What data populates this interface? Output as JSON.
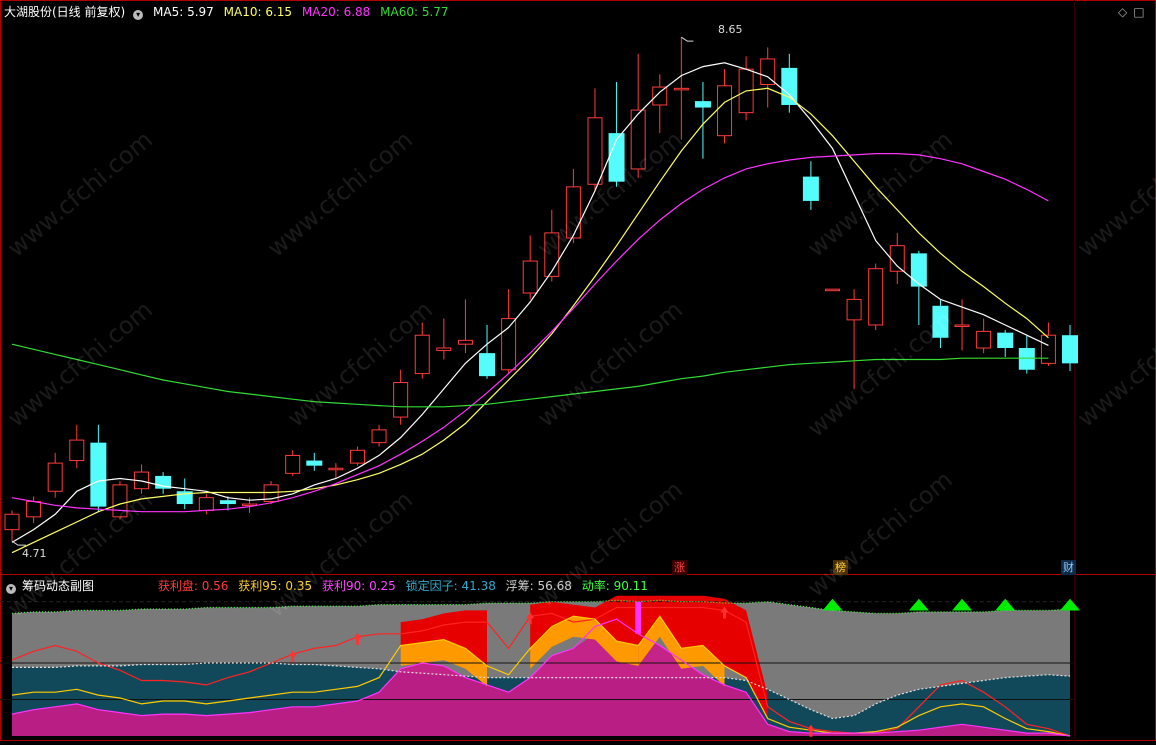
{
  "top_header": {
    "title": "大湖股份(日线 前复权)",
    "ma5_label": "MA5: 5.97",
    "ma10_label": "MA10: 6.15",
    "ma20_label": "MA20: 6.88",
    "ma60_label": "MA60: 5.77"
  },
  "top_icons": {
    "right_a": "◇",
    "right_b": "□"
  },
  "price_annotations": {
    "high": "8.65",
    "low": "4.71"
  },
  "event_tags": {
    "zhang": "涨",
    "bang": "榜",
    "cai": "财"
  },
  "bottom_header": {
    "title": "筹码动态副图",
    "huolipan": "获利盘: 0.56",
    "huoli95": "获利95: 0.35",
    "huoli90": "获利90: 0.25",
    "suoding": "锁定因子: 41.38",
    "fuchou": "浮筹: 56.68",
    "donglv": "动率: 90.11"
  },
  "watermark": "www.cfchi.com",
  "colors": {
    "up": "#ff3b3b",
    "down": "#54fcfc",
    "ma5": "#ffffff",
    "ma10": "#ffff66",
    "ma20": "#ff33ff",
    "ma60": "#33dd33",
    "grid": "#b00000",
    "gray_area": "#7a7a7a",
    "teal_area": "#12495a",
    "pink_area": "#cc1a88",
    "red_area": "#e60000",
    "orange_area": "#ff9900",
    "green_area": "#00ee00"
  },
  "chart_data": [
    {
      "type": "candlestick",
      "title": "大湖股份(日线 前复权)",
      "ylim": [
        4.5,
        8.8
      ],
      "candles": [
        [
          4.8,
          4.92,
          4.71,
          4.95
        ],
        [
          4.9,
          5.02,
          4.85,
          5.06
        ],
        [
          5.1,
          5.32,
          5.05,
          5.4
        ],
        [
          5.34,
          5.5,
          5.28,
          5.62
        ],
        [
          5.48,
          4.98,
          4.94,
          5.62
        ],
        [
          4.9,
          5.15,
          4.88,
          5.18
        ],
        [
          5.12,
          5.25,
          5.08,
          5.31
        ],
        [
          5.22,
          5.12,
          5.08,
          5.25
        ],
        [
          5.1,
          5.0,
          4.96,
          5.2
        ],
        [
          4.95,
          5.05,
          4.92,
          5.08
        ],
        [
          5.03,
          5.0,
          4.95,
          5.06
        ],
        [
          5.0,
          5.0,
          4.93,
          5.05
        ],
        [
          5.02,
          5.15,
          5.0,
          5.18
        ],
        [
          5.24,
          5.38,
          5.22,
          5.42
        ],
        [
          5.34,
          5.3,
          5.26,
          5.4
        ],
        [
          5.28,
          5.28,
          5.2,
          5.32
        ],
        [
          5.32,
          5.42,
          5.3,
          5.45
        ],
        [
          5.48,
          5.58,
          5.45,
          5.62
        ],
        [
          5.68,
          5.95,
          5.62,
          6.05
        ],
        [
          6.02,
          6.32,
          5.98,
          6.42
        ],
        [
          6.2,
          6.22,
          6.13,
          6.45
        ],
        [
          6.25,
          6.28,
          6.18,
          6.6
        ],
        [
          6.18,
          6.0,
          5.98,
          6.4
        ],
        [
          6.05,
          6.45,
          6.02,
          6.68
        ],
        [
          6.65,
          6.9,
          6.6,
          7.1
        ],
        [
          6.78,
          7.12,
          6.74,
          7.3
        ],
        [
          7.08,
          7.48,
          7.04,
          7.62
        ],
        [
          7.5,
          8.02,
          7.45,
          8.25
        ],
        [
          7.9,
          7.52,
          7.48,
          8.3
        ],
        [
          7.62,
          8.08,
          7.55,
          8.52
        ],
        [
          8.12,
          8.26,
          7.9,
          8.36
        ],
        [
          8.25,
          8.25,
          7.85,
          8.65
        ],
        [
          8.15,
          8.1,
          7.7,
          8.3
        ],
        [
          7.88,
          8.27,
          7.82,
          8.4
        ],
        [
          8.06,
          8.4,
          8.0,
          8.5
        ],
        [
          8.28,
          8.48,
          8.1,
          8.57
        ],
        [
          8.41,
          8.12,
          8.06,
          8.52
        ],
        [
          7.56,
          7.37,
          7.3,
          7.68
        ],
        [
          6.68,
          6.68,
          6.68,
          6.68
        ],
        [
          6.44,
          6.6,
          5.9,
          6.68
        ],
        [
          6.4,
          6.84,
          6.36,
          6.88
        ],
        [
          6.82,
          7.02,
          6.72,
          7.12
        ],
        [
          6.96,
          6.7,
          6.4,
          6.98
        ],
        [
          6.55,
          6.3,
          6.22,
          6.6
        ],
        [
          6.4,
          6.4,
          6.2,
          6.6
        ],
        [
          6.22,
          6.35,
          6.18,
          6.45
        ],
        [
          6.34,
          6.22,
          6.15,
          6.36
        ],
        [
          6.22,
          6.05,
          6.02,
          6.32
        ],
        [
          6.1,
          6.32,
          6.08,
          6.42
        ],
        [
          6.32,
          6.1,
          6.04,
          6.4
        ]
      ],
      "series": [
        {
          "name": "MA5",
          "values": [
            4.7,
            4.8,
            4.92,
            5.1,
            5.18,
            5.2,
            5.18,
            5.14,
            5.12,
            5.1,
            5.05,
            5.03,
            5.04,
            5.08,
            5.15,
            5.2,
            5.28,
            5.38,
            5.52,
            5.7,
            5.9,
            6.1,
            6.25,
            6.38,
            6.58,
            6.82,
            7.1,
            7.45,
            7.85,
            8.05,
            8.22,
            8.35,
            8.42,
            8.45,
            8.4,
            8.34,
            8.2,
            8.0,
            7.78,
            7.42,
            7.06,
            6.86,
            6.72,
            6.6,
            6.54,
            6.48,
            6.4,
            6.32,
            6.24,
            5.97
          ]
        },
        {
          "name": "MA10",
          "values": [
            4.62,
            4.7,
            4.78,
            4.86,
            4.94,
            5.0,
            5.04,
            5.06,
            5.08,
            5.09,
            5.09,
            5.09,
            5.09,
            5.1,
            5.12,
            5.15,
            5.19,
            5.24,
            5.31,
            5.39,
            5.5,
            5.63,
            5.8,
            5.97,
            6.14,
            6.33,
            6.55,
            6.78,
            7.02,
            7.27,
            7.52,
            7.76,
            7.97,
            8.14,
            8.23,
            8.25,
            8.18,
            8.05,
            7.88,
            7.68,
            7.48,
            7.3,
            7.12,
            6.96,
            6.82,
            6.7,
            6.57,
            6.45,
            6.3,
            6.15
          ]
        },
        {
          "name": "MA20",
          "values": [
            5.05,
            5.02,
            4.99,
            4.97,
            4.96,
            4.95,
            4.94,
            4.94,
            4.94,
            4.95,
            4.96,
            4.98,
            5.01,
            5.05,
            5.1,
            5.16,
            5.23,
            5.3,
            5.39,
            5.49,
            5.6,
            5.73,
            5.87,
            6.02,
            6.18,
            6.35,
            6.53,
            6.72,
            6.9,
            7.07,
            7.22,
            7.35,
            7.46,
            7.55,
            7.62,
            7.66,
            7.69,
            7.71,
            7.72,
            7.73,
            7.74,
            7.74,
            7.73,
            7.7,
            7.66,
            7.6,
            7.54,
            7.46,
            7.37,
            6.88
          ]
        },
        {
          "name": "MA60",
          "values": [
            6.25,
            6.21,
            6.17,
            6.13,
            6.09,
            6.05,
            6.01,
            5.97,
            5.94,
            5.91,
            5.88,
            5.86,
            5.84,
            5.82,
            5.8,
            5.79,
            5.78,
            5.77,
            5.76,
            5.76,
            5.76,
            5.77,
            5.78,
            5.8,
            5.82,
            5.84,
            5.86,
            5.88,
            5.9,
            5.92,
            5.95,
            5.98,
            6.0,
            6.03,
            6.05,
            6.07,
            6.09,
            6.1,
            6.11,
            6.12,
            6.13,
            6.13,
            6.13,
            6.13,
            6.14,
            6.14,
            6.14,
            6.14,
            6.14,
            5.77
          ]
        }
      ]
    },
    {
      "type": "area",
      "title": "筹码动态副图",
      "ylim": [
        0,
        100
      ],
      "series": [
        {
          "name": "浮筹",
          "values": [
            84,
            85,
            85,
            86,
            86,
            86,
            87,
            87,
            87,
            88,
            88,
            88,
            88,
            89,
            89,
            89,
            89,
            90,
            90,
            90,
            90,
            90,
            91,
            91,
            91,
            92,
            92,
            92,
            93,
            92,
            93,
            92,
            92,
            91,
            91,
            92,
            90,
            88,
            86,
            85,
            84,
            84,
            85,
            85,
            85,
            85,
            86,
            86,
            86,
            87
          ]
        },
        {
          "name": "锁定因子",
          "values": [
            47,
            47,
            47,
            48,
            48,
            48,
            49,
            49,
            49,
            50,
            50,
            50,
            50,
            49,
            49,
            48,
            47,
            46,
            44,
            43,
            42,
            41,
            40,
            40,
            40,
            40,
            40,
            40,
            40,
            40,
            40,
            40,
            40,
            40,
            38,
            32,
            25,
            18,
            12,
            14,
            22,
            28,
            32,
            34,
            36,
            38,
            40,
            41,
            42,
            41
          ]
        },
        {
          "name": "获利盘",
          "values": [
            52,
            58,
            62,
            58,
            50,
            45,
            38,
            38,
            37,
            35,
            40,
            44,
            50,
            56,
            60,
            62,
            68,
            70,
            70,
            72,
            76,
            78,
            78,
            60,
            82,
            84,
            78,
            80,
            88,
            88,
            88,
            88,
            88,
            86,
            78,
            20,
            10,
            5,
            3,
            2,
            2,
            5,
            20,
            35,
            38,
            30,
            20,
            8,
            5,
            0
          ]
        },
        {
          "name": "获利95",
          "values": [
            28,
            30,
            30,
            32,
            28,
            26,
            22,
            24,
            24,
            22,
            24,
            26,
            28,
            30,
            30,
            32,
            34,
            40,
            62,
            64,
            66,
            60,
            48,
            42,
            60,
            75,
            82,
            80,
            65,
            62,
            82,
            60,
            62,
            48,
            40,
            12,
            6,
            4,
            2,
            2,
            3,
            6,
            14,
            20,
            22,
            20,
            12,
            5,
            3,
            0
          ]
        },
        {
          "name": "获利90",
          "values": [
            15,
            18,
            20,
            22,
            18,
            16,
            14,
            15,
            15,
            14,
            15,
            16,
            18,
            20,
            20,
            22,
            24,
            30,
            46,
            50,
            48,
            40,
            35,
            30,
            40,
            55,
            60,
            75,
            80,
            70,
            62,
            52,
            42,
            35,
            30,
            8,
            3,
            2,
            2,
            2,
            2,
            3,
            4,
            6,
            8,
            6,
            4,
            2,
            2,
            0
          ]
        }
      ],
      "red_regions": [
        [
          18,
          22
        ],
        [
          24,
          29
        ],
        [
          29,
          35
        ]
      ],
      "orange_regions": [
        [
          18,
          22
        ],
        [
          24,
          29
        ],
        [
          29,
          33
        ]
      ],
      "up_arrows": [
        13,
        16,
        24,
        33,
        37
      ],
      "green_markers": [
        38,
        42,
        44,
        46,
        50
      ]
    }
  ]
}
